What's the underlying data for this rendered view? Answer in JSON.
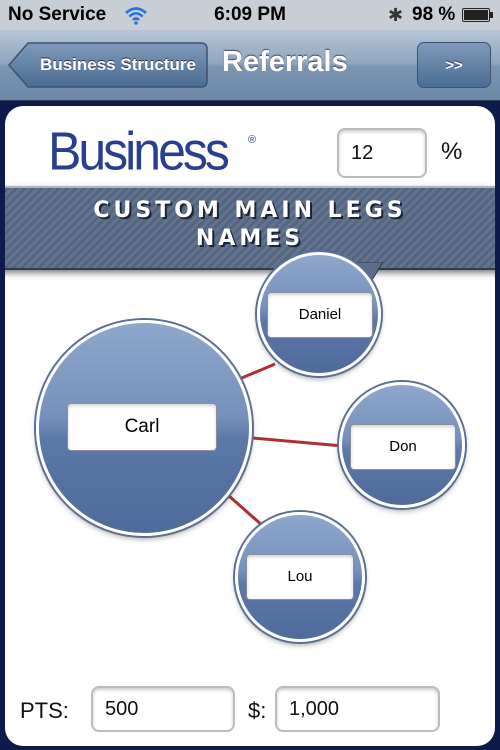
{
  "status_bar": {
    "carrier": "No Service",
    "time": "6:09 PM",
    "battery": "98 %",
    "battery_level": 0.98,
    "icons": [
      "wifi-icon",
      "bluetooth-icon",
      "battery-icon"
    ]
  },
  "nav": {
    "back_label": "Business Structure",
    "title": "Referrals",
    "forward_label": ">>"
  },
  "header": {
    "logo_text": "Business",
    "logo_mark": "®",
    "percent_value": "12",
    "percent_sign": "%"
  },
  "banner": {
    "line1": "CUSTOM MAIN LEGS",
    "line2": "NAMES"
  },
  "tree": {
    "root": "Carl",
    "legs": [
      "Daniel",
      "Don",
      "Lou"
    ]
  },
  "footer": {
    "pts_label": "PTS:",
    "pts_value": "500",
    "dollar_label": "$:",
    "dollar_value": "1,000"
  },
  "colors": {
    "navy_border": "#0d1b4a",
    "connector": "#b03030",
    "circle_blue": "#6a86b4",
    "logo_blue": "#2a3e8e"
  }
}
